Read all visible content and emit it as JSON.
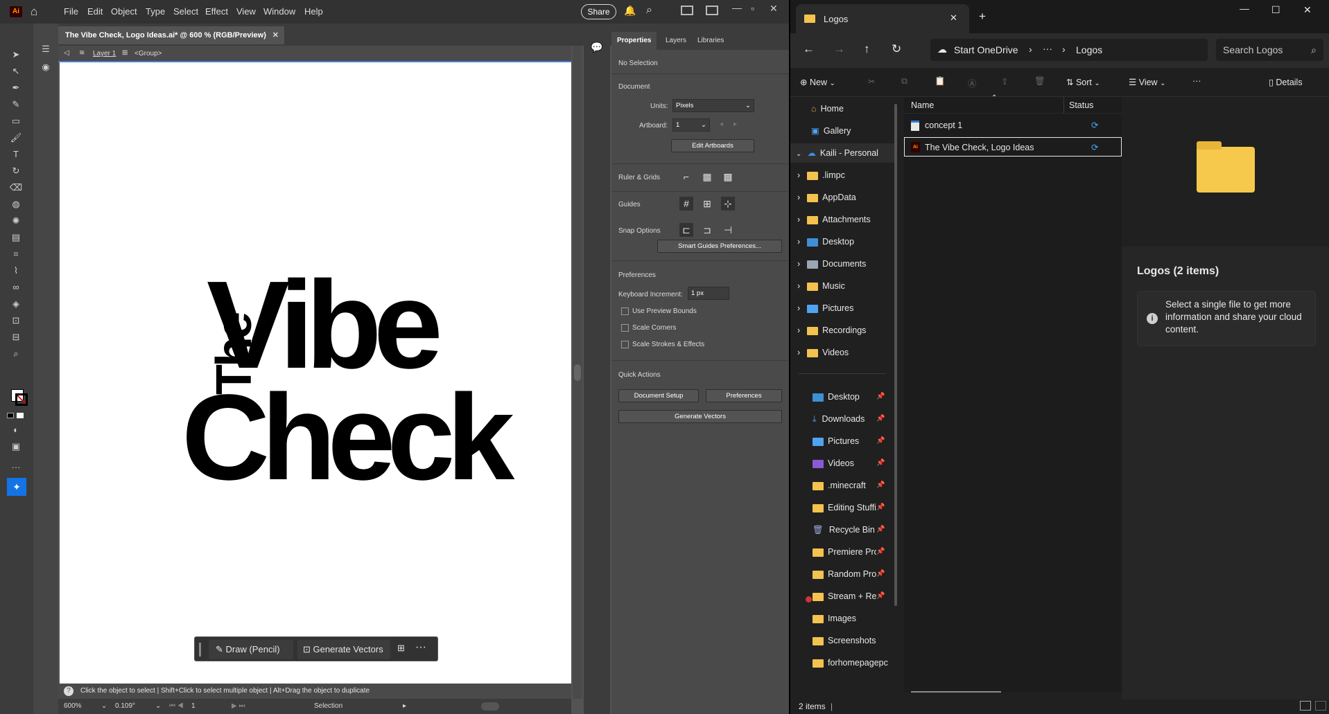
{
  "illustrator": {
    "logo": "Ai",
    "menus": [
      "File",
      "Edit",
      "Object",
      "Type",
      "Select",
      "Effect",
      "View",
      "Window",
      "Help"
    ],
    "share_label": "Share",
    "doc_tab": "The Vibe Check, Logo Ideas.ai* @ 600 % (RGB/Preview)",
    "breadcrumb": {
      "layer": "Layer 1",
      "group": "<Group>"
    },
    "artwork": {
      "line1": "The",
      "line2": "Vibe",
      "line3": "Check"
    },
    "context_bar": {
      "draw": "Draw (Pencil)",
      "generate": "Generate Vectors"
    },
    "status_hint": "Click the object to select  |  Shift+Click to select multiple object  |  Alt+Drag the object to duplicate",
    "bottom": {
      "zoom": "600%",
      "angle": "0.109°",
      "artboard": "1",
      "mode": "Selection"
    },
    "panel": {
      "tabs": [
        "Properties",
        "Layers",
        "Libraries"
      ],
      "no_selection": "No Selection",
      "document_header": "Document",
      "units_label": "Units:",
      "units_value": "Pixels",
      "artboard_label": "Artboard:",
      "artboard_value": "1",
      "edit_artboards": "Edit Artboards",
      "ruler_grids": "Ruler & Grids",
      "guides": "Guides",
      "snap_options": "Snap Options",
      "smart_guides": "Smart Guides Preferences...",
      "preferences_header": "Preferences",
      "keyboard_increment_label": "Keyboard Increment:",
      "keyboard_increment_value": "1 px",
      "use_preview_bounds": "Use Preview Bounds",
      "scale_corners": "Scale Corners",
      "scale_strokes": "Scale Strokes & Effects",
      "quick_actions": "Quick Actions",
      "document_setup": "Document Setup",
      "preferences_btn": "Preferences",
      "generate_vectors": "Generate Vectors"
    }
  },
  "explorer": {
    "tab_title": "Logos",
    "address": {
      "onedrive": "Start OneDrive",
      "ellipsis": "···",
      "folder": "Logos"
    },
    "search_placeholder": "Search Logos",
    "cmd": {
      "new": "New",
      "sort": "Sort",
      "view": "View",
      "more": "···",
      "details": "Details"
    },
    "sidebar_top": [
      {
        "label": "Home"
      },
      {
        "label": "Gallery"
      },
      {
        "label": "Kaili - Personal"
      }
    ],
    "sidebar_tree": [
      ".limpc",
      "AppData",
      "Attachments",
      "Desktop",
      "Documents",
      "Music",
      "Pictures",
      "Recordings",
      "Videos"
    ],
    "sidebar_pinned": [
      "Desktop",
      "Downloads",
      "Pictures",
      "Videos",
      ".minecraft",
      "Editing Stuffi",
      "Recycle Bin",
      "Premiere Pro",
      "Random Proj",
      "Stream + Rec",
      "Images",
      "Screenshots",
      "forhomepagepc"
    ],
    "columns": {
      "name": "Name",
      "status": "Status"
    },
    "files": [
      {
        "name": "concept 1",
        "type": "doc"
      },
      {
        "name": "The Vibe Check, Logo Ideas",
        "type": "ai"
      }
    ],
    "details": {
      "title": "Logos (2 items)",
      "info": "Select a single file to get more information and share your cloud content."
    },
    "status": "2 items"
  }
}
